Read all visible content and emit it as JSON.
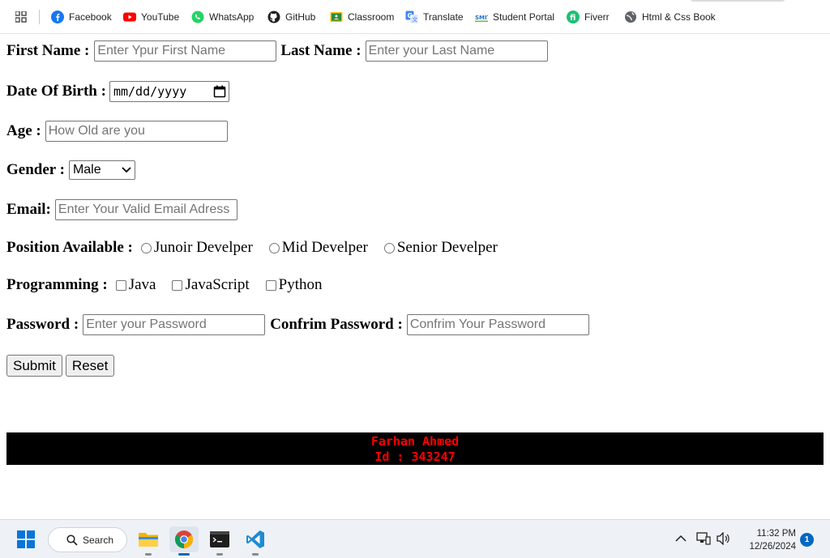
{
  "bookmarks": [
    {
      "label": "Facebook",
      "icon": "facebook-icon"
    },
    {
      "label": "YouTube",
      "icon": "youtube-icon"
    },
    {
      "label": "WhatsApp",
      "icon": "whatsapp-icon"
    },
    {
      "label": "GitHub",
      "icon": "github-icon"
    },
    {
      "label": "Classroom",
      "icon": "classroom-icon"
    },
    {
      "label": "Translate",
      "icon": "translate-icon"
    },
    {
      "label": "Student Portal",
      "icon": "smit-icon"
    },
    {
      "label": "Fiverr",
      "icon": "fiverr-icon"
    },
    {
      "label": "Html & Css Book",
      "icon": "globe-icon"
    }
  ],
  "form": {
    "first_name_label": "First Name :",
    "first_name_placeholder": "Enter Ypur First Name",
    "last_name_label": "Last Name :",
    "last_name_placeholder": "Enter your Last Name",
    "dob_label": "Date Of Birth :",
    "dob_value": "mm/dd/yyyy",
    "age_label": "Age :",
    "age_placeholder": "How Old are you",
    "gender_label": "Gender :",
    "gender_value": "Male",
    "email_label": "Email:",
    "email_placeholder": "Enter Your Valid Email Adress",
    "position_label": "Position Available :",
    "positions": [
      "Junoir Develper",
      "Mid Develper",
      "Senior Develper"
    ],
    "programming_label": "Programming :",
    "languages": [
      "Java",
      "JavaScript",
      "Python"
    ],
    "password_label": "Password :",
    "password_placeholder": "Enter your Password",
    "confirm_label": "Confrim Password :",
    "confirm_placeholder": "Confrim Your Password",
    "submit_label": "Submit",
    "reset_label": "Reset"
  },
  "footer": {
    "name": "Farhan Ahmed",
    "id": "Id : 343247"
  },
  "taskbar": {
    "search_label": "Search",
    "time": "11:32 PM",
    "date": "12/26/2024",
    "notifications": "1"
  },
  "colors": {
    "footer_bg": "#000000",
    "footer_text": "#ff0000",
    "accent": "#0067c0"
  }
}
